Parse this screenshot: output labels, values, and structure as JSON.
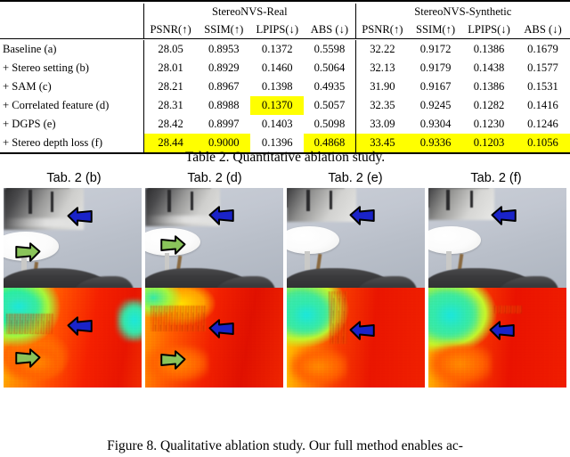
{
  "table": {
    "id": "Table 2",
    "caption": "Table 2. Quantitative ablation study.",
    "groups": [
      {
        "label": "StereoNVS-Real"
      },
      {
        "label": "StereoNVS-Synthetic"
      }
    ],
    "metrics": [
      "PSNR(↑)",
      "SSIM(↑)",
      "LPIPS(↓)",
      "ABS (↓)",
      "PSNR(↑)",
      "SSIM(↑)",
      "LPIPS(↓)",
      "ABS (↓)"
    ],
    "highlight_color": "#ffff00",
    "rows": [
      {
        "label": "Baseline (a)",
        "values": [
          "28.05",
          "0.8953",
          "0.1372",
          "0.5598",
          "32.22",
          "0.9172",
          "0.1386",
          "0.1679"
        ],
        "highlight": [
          false,
          false,
          false,
          false,
          false,
          false,
          false,
          false
        ]
      },
      {
        "label": "+ Stereo setting (b)",
        "values": [
          "28.01",
          "0.8929",
          "0.1460",
          "0.5064",
          "32.13",
          "0.9179",
          "0.1438",
          "0.1577"
        ],
        "highlight": [
          false,
          false,
          false,
          false,
          false,
          false,
          false,
          false
        ]
      },
      {
        "label": "+ SAM (c)",
        "values": [
          "28.21",
          "0.8967",
          "0.1398",
          "0.4935",
          "31.90",
          "0.9167",
          "0.1386",
          "0.1531"
        ],
        "highlight": [
          false,
          false,
          false,
          false,
          false,
          false,
          false,
          false
        ]
      },
      {
        "label": "+ Correlated feature (d)",
        "values": [
          "28.31",
          "0.8988",
          "0.1370",
          "0.5057",
          "32.35",
          "0.9245",
          "0.1282",
          "0.1416"
        ],
        "highlight": [
          false,
          false,
          true,
          false,
          false,
          false,
          false,
          false
        ]
      },
      {
        "label": "+ DGPS (e)",
        "values": [
          "28.42",
          "0.8997",
          "0.1403",
          "0.5098",
          "33.09",
          "0.9304",
          "0.1230",
          "0.1246"
        ],
        "highlight": [
          false,
          false,
          false,
          false,
          false,
          false,
          false,
          false
        ]
      },
      {
        "label": "+ Stereo depth loss (f)",
        "values": [
          "28.44",
          "0.9000",
          "0.1396",
          "0.4868",
          "33.45",
          "0.9336",
          "0.1203",
          "0.1056"
        ],
        "highlight": [
          true,
          true,
          false,
          true,
          true,
          true,
          true,
          true
        ]
      }
    ]
  },
  "figure": {
    "id": "Figure 8",
    "caption": "Figure 8. Qualitative ablation study. Our full method enables ac-",
    "columns": [
      {
        "label": "Tab. 2 (b)",
        "arrows": [
          "blue-arrow",
          "green-arrow"
        ]
      },
      {
        "label": "Tab. 2 (d)",
        "arrows": [
          "blue-arrow",
          "green-arrow"
        ]
      },
      {
        "label": "Tab. 2 (e)",
        "arrows": [
          "blue-arrow"
        ]
      },
      {
        "label": "Tab. 2 (f)",
        "arrows": [
          "blue-arrow"
        ]
      }
    ],
    "arrow_colors": {
      "blue": "#1a23c8",
      "green": "#8ac45a"
    },
    "rows": [
      "rgb-render",
      "depth-map"
    ]
  }
}
